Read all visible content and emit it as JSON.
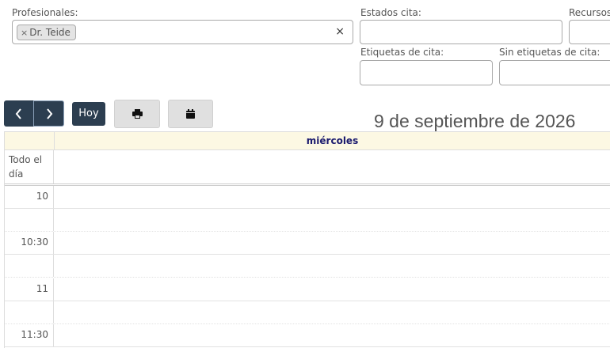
{
  "filters": {
    "profesionales_label": "Profesionales:",
    "selected_tag": "Dr. Teide",
    "tag_remove": "×",
    "clear": "×",
    "estados_label": "Estados cita:",
    "recursos_label": "Recursos",
    "etiquetas_label": "Etiquetas de cita:",
    "sin_etiquetas_label": "Sin etiquetas de cita:"
  },
  "toolbar": {
    "prev_icon": "chevron-left-icon",
    "next_icon": "chevron-right-icon",
    "today_label": "Hoy",
    "print_icon": "print-icon",
    "calendar_icon": "calendar-icon"
  },
  "calendar": {
    "date_title": "9 de septiembre de 2026",
    "day_name": "miércoles",
    "allday_label": "Todo el día",
    "times": [
      "10",
      "10:30",
      "11",
      "11:30"
    ]
  },
  "colors": {
    "nav_dark": "#2c3e50",
    "header_bg": "#fcf8e3",
    "day_text": "#1a1a6e"
  }
}
